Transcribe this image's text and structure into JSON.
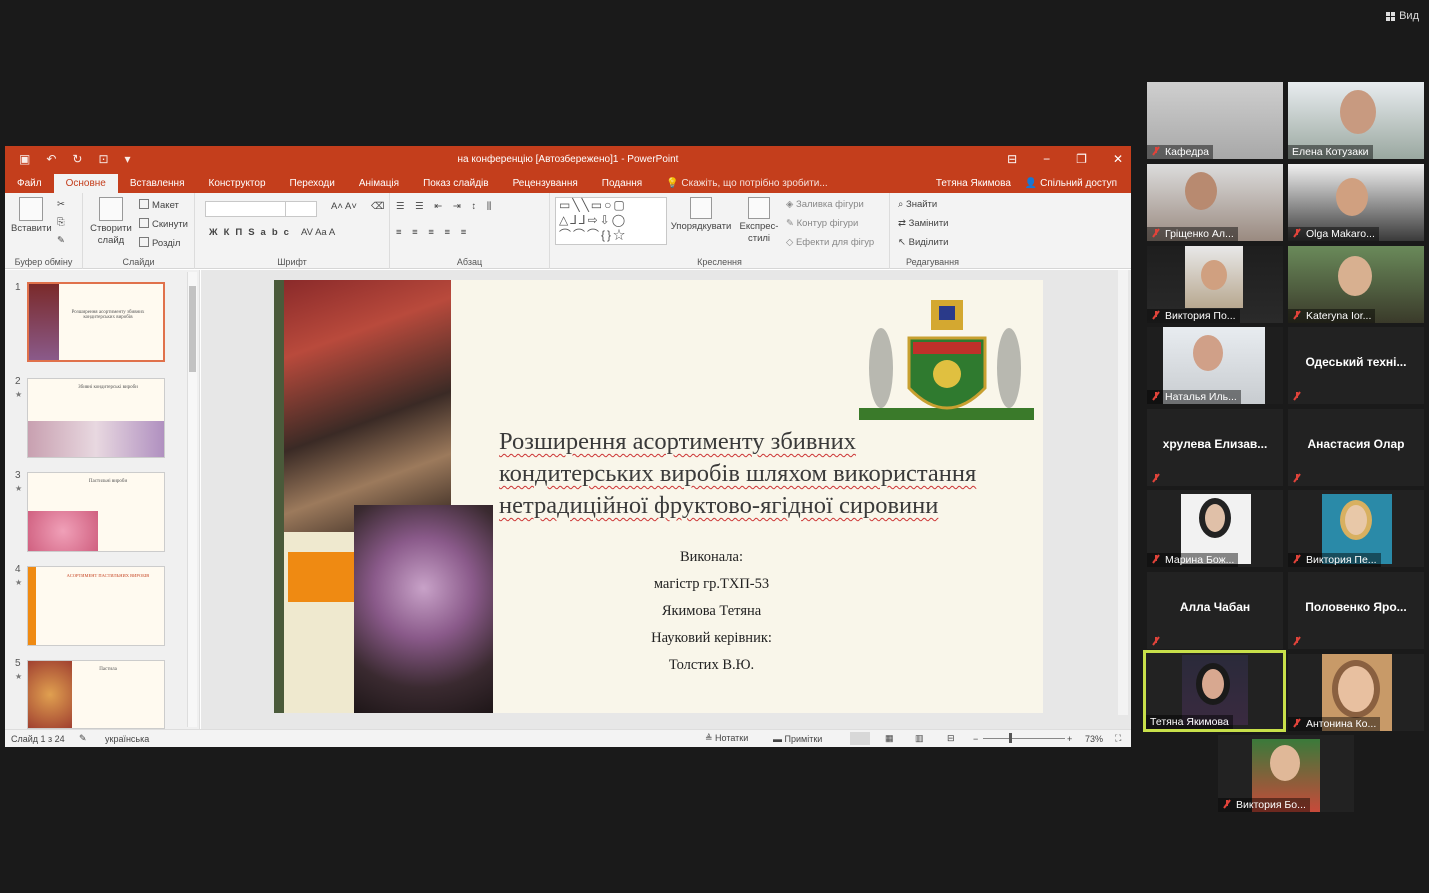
{
  "zoom": {
    "view_label": "Вид"
  },
  "ppt": {
    "title": "на конференцію [Автозбережено]1 - PowerPoint",
    "tabs": [
      "Файл",
      "Основне",
      "Вставлення",
      "Конструктор",
      "Переходи",
      "Анімація",
      "Показ слайдів",
      "Рецензування",
      "Подання"
    ],
    "active_tab": "Основне",
    "tell_me": "Скажіть, що потрібно зробити...",
    "user": "Тетяна Якимова",
    "share": "Спільний доступ",
    "ribbon": {
      "paste": "Вставити",
      "clipboard": "Буфер обміну",
      "new_slide": "Створити слайд",
      "layout": "Макет",
      "reset": "Скинути",
      "section": "Розділ",
      "slides": "Слайди",
      "font": "Шрифт",
      "paragraph": "Абзац",
      "arrange": "Упорядкувати",
      "quick_styles": "Експрес-стилі",
      "shape_fill": "Заливка фігури",
      "shape_outline": "Контур фігури",
      "shape_effects": "Ефекти для фігур",
      "drawing": "Креслення",
      "find": "Знайти",
      "replace": "Замінити",
      "select": "Виділити",
      "editing": "Редагування"
    },
    "thumbnails": [
      {
        "num": "1",
        "title": "Розширення асортименту збивних кондитерських виробів"
      },
      {
        "num": "2",
        "title": "Збивні кондитерські вироби"
      },
      {
        "num": "3",
        "title": "Пастильні вироби"
      },
      {
        "num": "4",
        "title": "АСОРТИМЕНТ ПАСТИЛЬНИХ ВИРОБІВ"
      },
      {
        "num": "5",
        "title": "Пастила"
      }
    ],
    "slide": {
      "title_lines": [
        "Розширення асортименту збивних",
        "кондитерських виробів шляхом використання",
        "нетрадиційної фруктово-ягідної сировини"
      ],
      "info_lines": [
        "Виконала:",
        "магістр гр.ТХП-53",
        "Якимова Тетяна",
        "Науковий керівник:",
        "Толстих В.Ю."
      ]
    },
    "status": {
      "slide_of": "Слайд 1 з 24",
      "language": "українська",
      "notes": "Нотатки",
      "comments": "Примітки",
      "zoom": "73%"
    }
  },
  "participants": [
    {
      "name": "Кафедра",
      "type": "video"
    },
    {
      "name": "Елена Котузаки",
      "type": "video"
    },
    {
      "name": "Гріщенко Ал...",
      "type": "video"
    },
    {
      "name": "Olga Makaro...",
      "type": "video"
    },
    {
      "name": "Виктория По...",
      "type": "video"
    },
    {
      "name": "Kateryna Ior...",
      "type": "video"
    },
    {
      "name": "Наталья Иль...",
      "type": "video"
    },
    {
      "name": "Одеський техні...",
      "type": "name"
    },
    {
      "name": "хрулева Елизав...",
      "type": "name"
    },
    {
      "name": "Анастасия Олар",
      "type": "name"
    },
    {
      "name": "Марина Бож...",
      "type": "video"
    },
    {
      "name": "Виктория Пе...",
      "type": "video"
    },
    {
      "name": "Алла Чабан",
      "type": "name"
    },
    {
      "name": "Половенко Яро...",
      "type": "name"
    },
    {
      "name": "Тетяна Якимова",
      "type": "video",
      "active": true
    },
    {
      "name": "Антонина Ко...",
      "type": "video"
    },
    {
      "name": "Виктория Бо...",
      "type": "video"
    }
  ],
  "colors": {
    "ppt_accent": "#c43e1c",
    "active_speaker": "#c8e04a",
    "muted": "#e0433a"
  }
}
